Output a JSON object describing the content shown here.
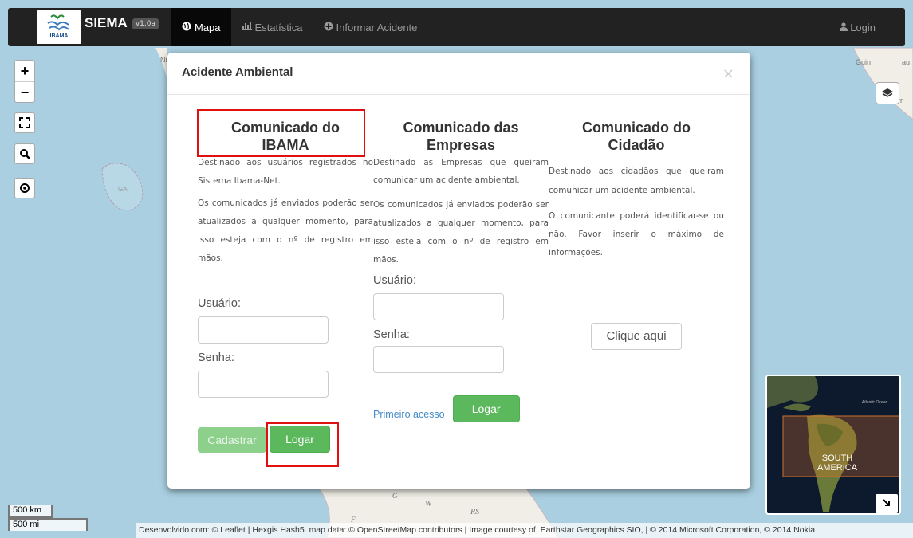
{
  "navbar": {
    "brand": "SIEMA",
    "logo_text": "IBAMA",
    "version": "v1.0a",
    "items": [
      {
        "icon": "globe-icon",
        "glyph": "●",
        "label": "Mapa",
        "active": true
      },
      {
        "icon": "bar-chart-icon",
        "glyph": "▁▃▅",
        "label": "Estatística",
        "active": false
      },
      {
        "icon": "plus-circle-icon",
        "glyph": "⊕",
        "label": "Informar Acidente",
        "active": false
      }
    ],
    "login_icon": "user-icon",
    "login": "Login"
  },
  "map": {
    "scale_km": "500 km",
    "scale_mi": "500 mi",
    "attribution": "Desenvolvido com: © Leaflet | Hexgis Hash5. map data: © OpenStreetMap contributors | Image courtesy of, Earthstar Geographics SIO, | © 2014 Microsoft Corporation, © 2014 Nokia",
    "labels": {
      "ga": "GA",
      "ni": "Ni",
      "guin": "Guin",
      "au": "au",
      "sierra": "Sierr",
      "w": "W",
      "rs": "RS",
      "f": "F",
      "g": "G"
    },
    "minimap": {
      "ocean": "Atlantic Ocean",
      "continent_line1": "SOUTH",
      "continent_line2": "AMERICA"
    },
    "controls": [
      "zoom-in",
      "zoom-out",
      "fullscreen",
      "search",
      "locate",
      "layers",
      "minimap-toggle"
    ]
  },
  "modal": {
    "title": "Acidente Ambiental",
    "close": "×",
    "ibama": {
      "title_line1": "Comunicado do",
      "title_line2": "IBAMA",
      "p1": "Destinado aos usuários registrados no Sistema Ibama-Net.",
      "p2": "Os comunicados já enviados poderão ser atualizados a qualquer momento, para isso esteja com o nº de registro em mãos.",
      "user_label": "Usuário:",
      "pass_label": "Senha:",
      "register": "Cadastrar",
      "login": "Logar"
    },
    "empresas": {
      "title_line1": "Comunicado das",
      "title_line2": "Empresas",
      "p1": "Destinado as Empresas que queiram comunicar um acidente ambiental.",
      "p2": "Os comunicados já enviados poderão ser atualizados a qualquer momento, para isso esteja com o nº de registro em mãos.",
      "user_label": "Usuário:",
      "pass_label": "Senha:",
      "first_access": "Primeiro acesso",
      "login": "Logar"
    },
    "cidadao": {
      "title_line1": "Comunicado do",
      "title_line2": "Cidadão",
      "p1": "Destinado aos cidadãos que queiram comunicar um acidente ambiental.",
      "p2": "O comunicante poderá identificar-se ou não. Favor inserir o máximo de informações.",
      "button": "Clique aqui"
    }
  },
  "colors": {
    "highlight": "#e01010",
    "navbar": "#222222",
    "success": "#5cb85c",
    "link": "#428bca"
  }
}
